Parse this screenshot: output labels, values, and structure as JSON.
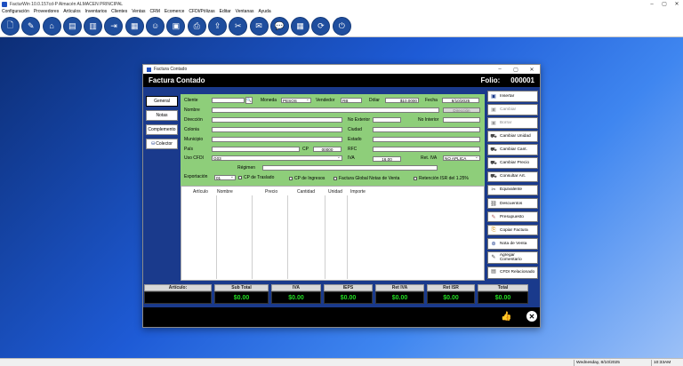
{
  "window": {
    "title": "FacturWin 10.0.157cd-P Almacén ALMACEN PRINCIPAL"
  },
  "menu": [
    "Configuración",
    "Proveedores",
    "Artículos",
    "Inventarios",
    "Clientes",
    "Ventas",
    "CRM",
    "Ecomerce",
    "CFDI/Pólizas",
    "Editar",
    "Ventanas",
    "Ayuda"
  ],
  "dialog": {
    "title": "Factura Contado",
    "header_title": "Factura Contado",
    "folio_label": "Folio:",
    "folio_value": "000001",
    "side_tabs": [
      "General",
      "Notas",
      "Complemento",
      "Colector"
    ],
    "labels": {
      "cliente": "Cliente",
      "moneda": "Moneda",
      "vendedor": "Vendedor",
      "dolar": "Dólar",
      "fecha": "Fecha",
      "nombre": "Nombre",
      "direccion": "Dirección",
      "no_exterior": "No Exterior",
      "no_interior": "No Interior",
      "colonia": "Colonia",
      "ciudad": "Ciudad",
      "municipio": "Municipio",
      "estado": "Estado",
      "pais": "País",
      "cp": "CP",
      "rfc": "RFC",
      "uso_cfdi": "Uso CFDI",
      "iva": "IVA",
      "ret_iva": "Ret. IVA",
      "regimen": "Régimen",
      "exportacion": "Exportación",
      "cp_traslado": "CP de Traslado",
      "cp_ingresos": "CP de Ingresos",
      "factura_global": "Factura Global Notas de Venta",
      "retencion_isr": "Retención ISR del 1.25%"
    },
    "values": {
      "moneda": "PESOS",
      "vendedor": "RB",
      "dolar": "$10.0000",
      "fecha": "8/10/2025",
      "direccion_btn": "Dirección",
      "cp": "00000",
      "uso_cfdi": "G03",
      "iva": "16.00",
      "ret_iva": "NO APLICA",
      "exportacion": "01"
    },
    "grid_columns": [
      "Artículo",
      "Nombre",
      "Precio",
      "Cantidad",
      "Unidad",
      "Importe"
    ],
    "right_buttons": [
      "Insertar",
      "Cambiar",
      "Borrar",
      "Cambiar Unidad",
      "Cambiar Cant.",
      "Cambiar Precio",
      "Consultar Art.",
      "Equivalente",
      "Descuentos",
      "Presupuesto",
      "Copiar Factura",
      "Nota de Venta",
      "Agregar Comentario",
      "CFDI Relacionado"
    ],
    "totals": [
      {
        "label": "Artículo:",
        "value": ""
      },
      {
        "label": "Sub Total",
        "value": "$0.00"
      },
      {
        "label": "IVA",
        "value": "$0.00"
      },
      {
        "label": "IEPS",
        "value": "$0.00"
      },
      {
        "label": "Ret IVA",
        "value": "$0.00"
      },
      {
        "label": "Ret ISR",
        "value": "$0.00"
      },
      {
        "label": "Total",
        "value": "$0.00"
      }
    ]
  },
  "statusbar": {
    "date": "Wednesday, 8/10/2025",
    "time": "10:33AM"
  }
}
